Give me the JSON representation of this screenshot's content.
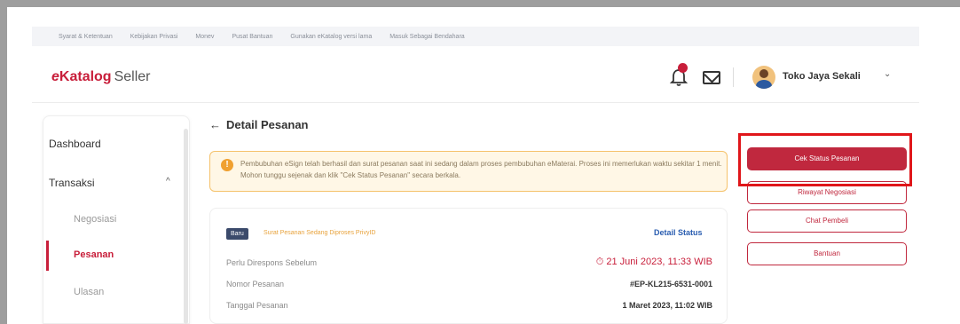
{
  "site_links": [
    "Syarat & Ketentuan",
    "Kebijakan Privasi",
    "Monev",
    "Pusat Bantuan",
    "Gunakan eKatalog versi lama",
    "Masuk Sebagai Bendahara"
  ],
  "header": {
    "logo_mark": "e",
    "logo_name": "Katalog",
    "logo_sub": "Seller",
    "notification_count": "",
    "username": "Toko Jaya Sekali",
    "caret": "⌄"
  },
  "sidebar": {
    "dashboard": "Dashboard",
    "transaksi": "Transaksi",
    "transaksi_caret": "^",
    "negosiasi": "Negosiasi",
    "pesanan": "Pesanan",
    "ulasan": "Ulasan"
  },
  "main": {
    "back_arrow": "←",
    "title": "Detail Pesanan",
    "alert_icon": "!",
    "alert_text": "Pembubuhan eSign telah berhasil dan surat pesanan saat ini sedang dalam proses pembubuhan eMaterai. Proses ini memerlukan waktu sekitar 1 menit. Mohon tunggu sejenak dan klik \"Cek Status Pesanan\" secara berkala.",
    "card": {
      "badge": "Baru",
      "status_text": "Surat Pesanan Sedang Diproses PrivyID",
      "detail_link": "Detail Status",
      "rows": [
        {
          "label": "Perlu Direspons Sebelum",
          "value": "⏱ 21 Juni 2023, 11:33 WIB"
        },
        {
          "label": "Nomor Pesanan",
          "value": "#EP-KL215-6531-0001"
        },
        {
          "label": "Tanggal Pesanan",
          "value": "1 Maret 2023, 11:02 WIB"
        }
      ]
    }
  },
  "actions": {
    "cek_status": "Cek Status Pesanan",
    "riwayat": "Riwayat Negosiasi",
    "chat": "Chat Pembeli",
    "bantuan": "Bantuan"
  },
  "colors": {
    "accent": "#c0283e",
    "highlight": "#e0161a",
    "alert_bg": "#fff7e6",
    "link": "#2a5db0"
  }
}
